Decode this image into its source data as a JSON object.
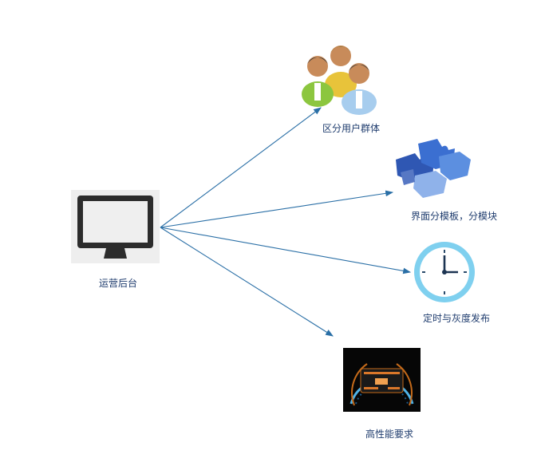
{
  "diagram": {
    "source": {
      "label": "运营后台",
      "icon": "monitor-icon"
    },
    "targets": [
      {
        "label": "区分用户群体",
        "icon": "users-group-icon"
      },
      {
        "label": "界面分模板，分模块",
        "icon": "puzzle-pieces-icon"
      },
      {
        "label": "定时与灰度发布",
        "icon": "clock-icon"
      },
      {
        "label": "高性能要求",
        "icon": "speedometer-icon"
      }
    ],
    "colors": {
      "arrow": "#2a6fa6",
      "label_text": "#1f3c6e"
    }
  }
}
